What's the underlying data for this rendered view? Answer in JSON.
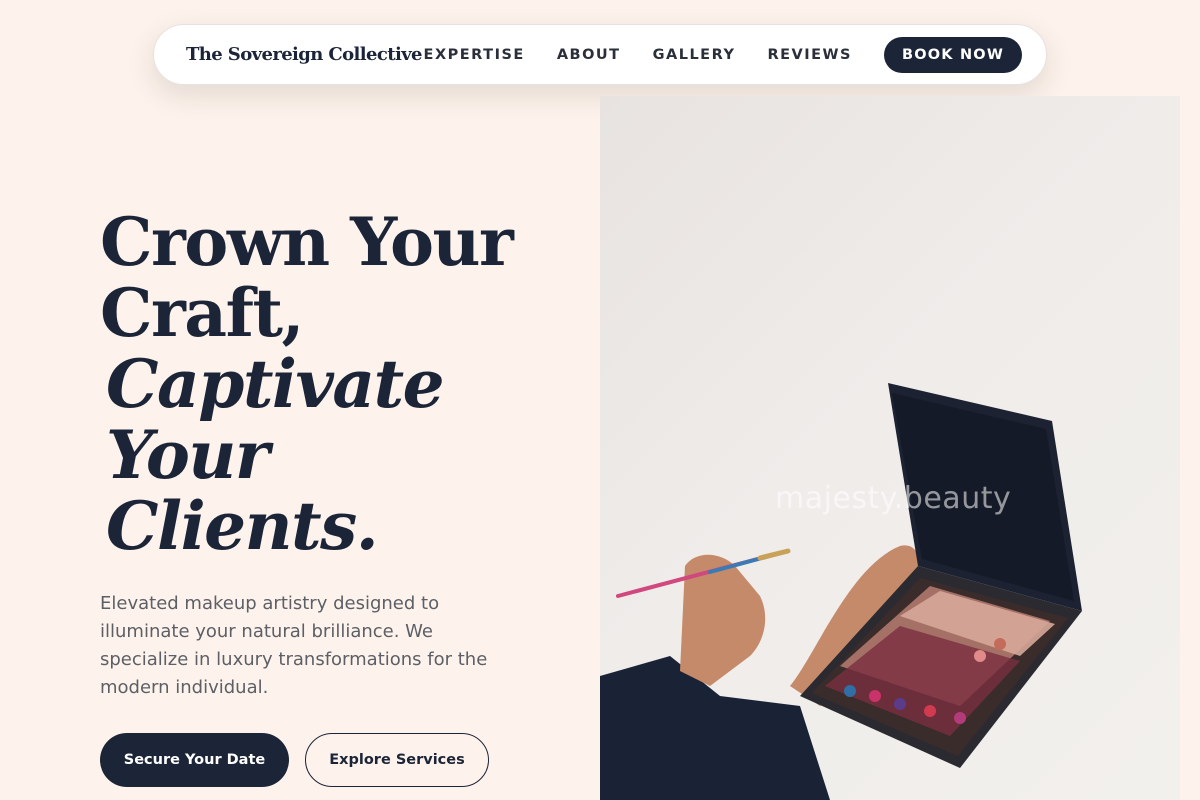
{
  "nav": {
    "brand": "The Sovereign Collective",
    "links": [
      "EXPERTISE",
      "ABOUT",
      "GALLERY",
      "REVIEWS"
    ],
    "cta": "BOOK NOW"
  },
  "hero": {
    "title_lines": [
      "Crown Your",
      "Craft,",
      "Captivate",
      "Your",
      "Clients."
    ],
    "description": "Elevated makeup artistry designed to illuminate your natural brilliance. We specialize in luxury transformations for the modern individual.",
    "primary_button": "Secure Your Date",
    "secondary_button": "Explore Services"
  },
  "image": {
    "watermark": "majesty.beauty"
  },
  "colors": {
    "background": "#fdf3ec",
    "navy": "#1c2538",
    "text_muted": "#5c5f66"
  }
}
